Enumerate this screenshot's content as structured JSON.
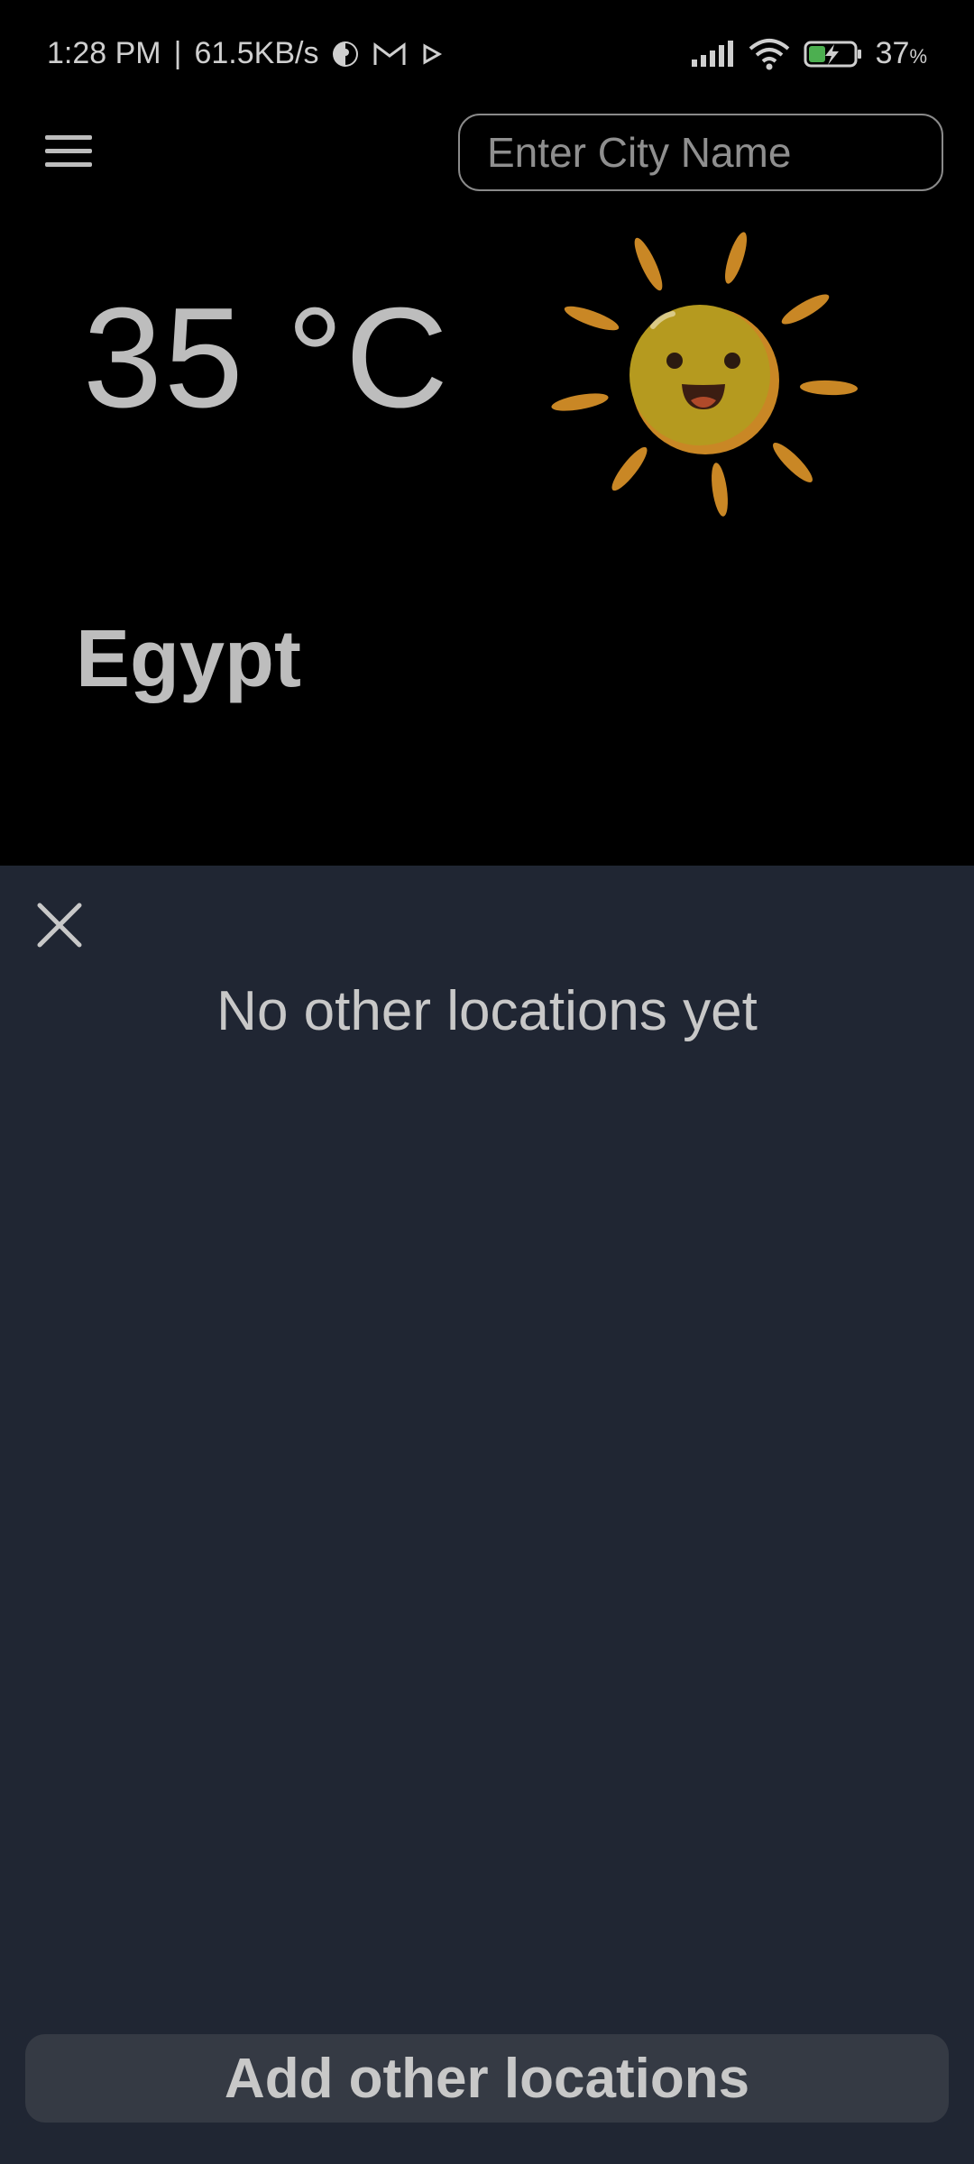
{
  "status_bar": {
    "time": "1:28 PM",
    "separator": "|",
    "network_speed": "61.5KB/s",
    "battery_percent": "37",
    "battery_unit": "%",
    "icons": [
      "app-notification-icon",
      "gmail-icon",
      "play-icon",
      "signal-icon",
      "wifi-icon",
      "battery-charging-icon"
    ]
  },
  "header": {
    "menu_icon": "hamburger-menu-icon",
    "search_placeholder": "Enter City Name"
  },
  "weather": {
    "temperature": "35 °C",
    "icon": "sun-icon",
    "city": "Egypt"
  },
  "sheet": {
    "close_icon": "close-icon",
    "empty_message": "No other locations yet",
    "add_button_label": "Add other locations"
  },
  "colors": {
    "background": "#000000",
    "sheet_background": "#202633",
    "button_background": "#353a44",
    "text": "#c8c8c8",
    "sun_body": "#b59a1f",
    "sun_rays": "#c98725"
  }
}
